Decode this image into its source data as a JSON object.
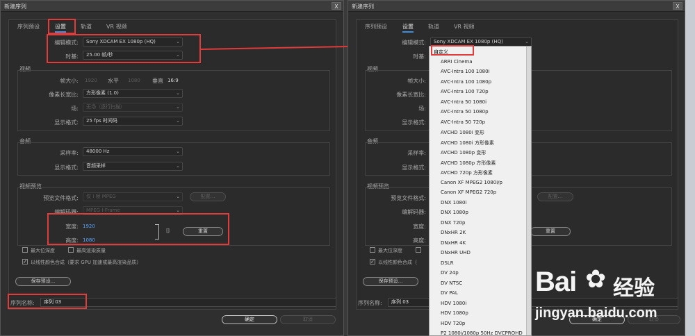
{
  "left": {
    "title": "新建序列",
    "close": "X",
    "tabs": [
      "序列预设",
      "设置",
      "轨道",
      "VR 视频"
    ],
    "editing_mode_label": "编辑模式:",
    "editing_mode_value": "Sony XDCAM EX 1080p (HQ)",
    "timebase_label": "时基:",
    "timebase_value": "25.00  帧/秒",
    "video_group": "视频",
    "frame_size_label": "帧大小:",
    "frame_w": "1920",
    "horizontal_label": "水平",
    "frame_h": "1080",
    "vertical_label": "垂直",
    "aspect": "16:9",
    "pixel_aspect_label": "像素长宽比:",
    "pixel_aspect_value": "方形像素 (1.0)",
    "field_label": "场:",
    "field_value": "无场（逐行扫描）",
    "display_format_label": "显示格式:",
    "display_format_value": "25 fps 时间码",
    "audio_group": "音频",
    "sample_rate_label": "采样率:",
    "sample_rate_value": "48000 Hz",
    "audio_display_label": "显示格式:",
    "audio_display_value": "音频采样",
    "preview_group": "视频预览",
    "preview_format_label": "预览文件格式:",
    "preview_format_value": "仅 I 帧 MPEG",
    "config_button": "配置...",
    "codec_label": "编解码器:",
    "codec_value": "MPEG I-Frame",
    "width_label": "宽度:",
    "width_value": "1920",
    "height_label": "高度:",
    "height_value": "1080",
    "reset_button": "重置",
    "max_depth": "最大位深度",
    "max_quality": "最高渲染质量",
    "linear_color": "以线性颜色合成（要求 GPU 加速或最高渲染品质）",
    "save_preset": "保存预设...",
    "seq_name_label": "序列名称:",
    "seq_name_value": "序列 03",
    "ok": "确定",
    "cancel": "取消"
  },
  "right": {
    "title": "新建序列",
    "close": "X",
    "tabs": [
      "序列预设",
      "设置",
      "轨道",
      "VR 视频"
    ],
    "editing_mode_label": "编辑模式:",
    "editing_mode_value": "Sony XDCAM EX 1080p (HQ)",
    "timebase_label": "时基:",
    "video_group": "视频",
    "frame_size_label": "帧大小:",
    "pixel_aspect_label": "像素长宽比:",
    "field_label": "场:",
    "display_format_label": "显示格式:",
    "audio_group": "音频",
    "sample_rate_label": "采样率:",
    "audio_display_label": "显示格式:",
    "preview_group": "视频预览",
    "preview_format_label": "预览文件格式:",
    "config_button": "配置...",
    "codec_label": "编解码器:",
    "width_label": "宽度:",
    "height_label": "高度:",
    "reset_button": "重置",
    "max_depth": "最大位深度",
    "linear_color": "以线性颜色合成（",
    "save_preset": "保存预设...",
    "seq_name_label": "序列名称:",
    "seq_name_value": "序列 03",
    "ok": "确定",
    "cancel": "取消"
  },
  "dropdown_items": [
    "自定义",
    "ARRI Cinema",
    "AVC-Intra 100 1080i",
    "AVC-Intra 100 1080p",
    "AVC-Intra 100 720p",
    "AVC-Intra 50 1080i",
    "AVC-Intra 50 1080p",
    "AVC-Intra 50 720p",
    "AVCHD 1080i 变形",
    "AVCHD 1080i 方形像素",
    "AVCHD 1080p 变形",
    "AVCHD 1080p 方形像素",
    "AVCHD 720p 方形像素",
    "Canon XF MPEG2 1080i/p",
    "Canon XF MPEG2 720p",
    "DNX 1080i",
    "DNX 1080p",
    "DNX 720p",
    "DNxHR 2K",
    "DNxHR 4K",
    "DNxHR UHD",
    "DSLR",
    "DV 24p",
    "DV NTSC",
    "DV PAL",
    "HDV 1080i",
    "HDV 1080p",
    "HDV 720p",
    "P2 1080i/1080p 50Hz DVCPROHD"
  ],
  "watermark": {
    "brand": "Bai",
    "brand2": "经验",
    "url": "jingyan.baidu.com"
  },
  "colors": {
    "accent": "#3a8ee6",
    "highlight": "#e03c3c",
    "link": "#5aa7ff"
  }
}
